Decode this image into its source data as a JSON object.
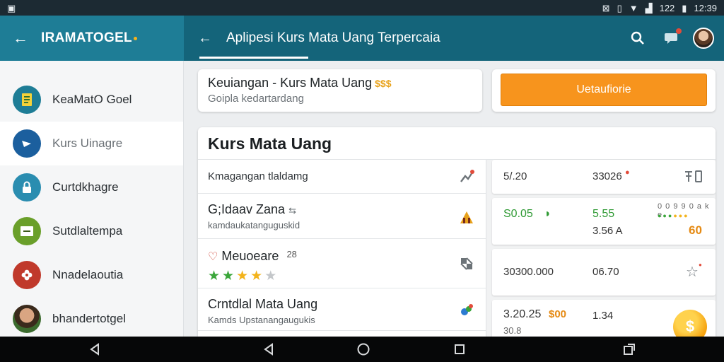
{
  "status_bar": {
    "time": "12:39",
    "signal_text": "122"
  },
  "app": {
    "brand": "IRAMATOGEL",
    "screen_title": "Aplipesi Kurs Mata Uang Terpercaia"
  },
  "drawer": {
    "items": [
      {
        "label": "KeaMatO Goel",
        "icon": "document-icon",
        "color": "#1e7d96"
      },
      {
        "label": "Kurs Uinagre",
        "icon": "currency-icon",
        "color": "#1b5f9e"
      },
      {
        "label": "Curtdkhagre",
        "icon": "lock-icon",
        "color": "#2a8db0"
      },
      {
        "label": "Sutdlaltempa",
        "icon": "chart-icon",
        "color": "#6a9f2a"
      },
      {
        "label": "Nnadelaoutia",
        "icon": "flower-icon",
        "color": "#c0392b"
      },
      {
        "label": "bhandertotgel",
        "icon": "user-avatar",
        "color": "#3b6b2e"
      }
    ]
  },
  "header_card": {
    "title": "Keuiangan - Kurs Mata Uang",
    "title_badge": "$$$",
    "subtitle": "Goipla kedartardang"
  },
  "cta": {
    "label": "Uetaufiorie",
    "color": "#f7941d"
  },
  "main_card": {
    "title": "Kurs Mata Uang",
    "list": [
      {
        "title": "Kmagangan tlaldamg",
        "sub": "",
        "icon": "chart-up-icon"
      },
      {
        "title": "G;Idaav Zana",
        "sub": "kamdaukatanguguskid",
        "icon": "building-icon"
      },
      {
        "title": "Meuoeare",
        "title_extra": "28",
        "rating": 4,
        "stars_total": 5,
        "icon": "grid-icon"
      },
      {
        "title": "Crntdlal Mata Uang",
        "sub": "Kamds Upstanangaugukis",
        "icon": "globe-dots-icon"
      }
    ],
    "rates": [
      {
        "a": "5/.20",
        "b": "33026",
        "c": ""
      },
      {
        "a": "S0.05",
        "b": "5.55",
        "c": "3.56 A",
        "d": "0 0 9 9 0 a k e",
        "e": "60"
      },
      {
        "a": "30300.000",
        "b": "06.70",
        "c": ""
      },
      {
        "a": "3.20.25",
        "a_extra": "$00",
        "b": "1.34",
        "c": "30.8",
        "coin": "$"
      }
    ]
  },
  "nav": {
    "back": "back",
    "home": "home",
    "recents": "recents",
    "rotate": "rotate"
  }
}
